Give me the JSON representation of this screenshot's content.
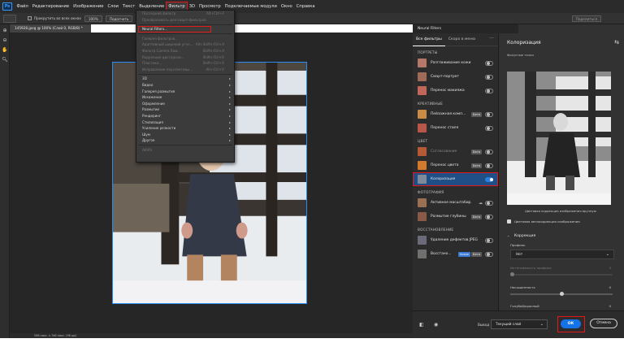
{
  "menubar": {
    "logo": "Ps",
    "items": [
      "Файл",
      "Редактирование",
      "Изображение",
      "Слои",
      "Текст",
      "Выделение",
      "Фильтр",
      "3D",
      "Просмотр",
      "Подключаемые модули",
      "Окно",
      "Справка"
    ],
    "active_index": 6
  },
  "options": {
    "scroll_all": "Прокрутить во всех окнах",
    "zoom_100": "100%",
    "fit_screen": "Подогнать",
    "full_screen": "Заполнить",
    "right_btn": "Поделиться"
  },
  "document": {
    "tab": "145928.jpeg @ 100% (Слой 0, RGB/8) *",
    "status": "598 пикс. х 746 пикс. (96 ppi)"
  },
  "filter_menu": {
    "group1": [
      {
        "label": "Последний фильтр",
        "shortcut": "Alt+Ctrl+F"
      },
      {
        "label": "Преобразовать для смарт-фильтров",
        "shortcut": ""
      }
    ],
    "neural": "Neural Filters...",
    "group2": [
      {
        "label": "Галерея фильтров...",
        "shortcut": ""
      },
      {
        "label": "Адаптивный широкий угол...",
        "shortcut": "Alt+Shift+Ctrl+A"
      },
      {
        "label": "Фильтр Camera Raw...",
        "shortcut": "Shift+Ctrl+A"
      },
      {
        "label": "Коррекция дисторсии...",
        "shortcut": "Shift+Ctrl+R"
      },
      {
        "label": "Пластика...",
        "shortcut": "Shift+Ctrl+X"
      },
      {
        "label": "Исправление перспективы...",
        "shortcut": "Alt+Ctrl+V"
      }
    ],
    "group3": [
      "3D",
      "Видео",
      "Галерея размытия",
      "Искажение",
      "Оформление",
      "Размытие",
      "Рендеринг",
      "Стилизация",
      "Усиление резкости",
      "Шум",
      "Другое"
    ],
    "group4": [
      "AKVIS"
    ]
  },
  "neural": {
    "panel_tab": "Neural Filters",
    "tabs": [
      "Все фильтры",
      "Скоро в меню"
    ],
    "more": "···",
    "categories": [
      {
        "title": "ПОРТРЕТЫ",
        "items": [
          {
            "label": "Разглаживание кожи",
            "badge": "",
            "state": "off",
            "cloud": false,
            "dim": false,
            "thumb": "#b4776a"
          },
          {
            "label": "Смарт-портрет",
            "badge": "",
            "state": "off",
            "cloud": false,
            "dim": false,
            "thumb": "#a06a58"
          },
          {
            "label": "Перенос макияжа",
            "badge": "",
            "state": "off",
            "cloud": false,
            "dim": false,
            "thumb": "#c0675a"
          }
        ]
      },
      {
        "title": "КРЕАТИВНЫЕ",
        "items": [
          {
            "label": "Пейзажная комп...",
            "badge": "Бета",
            "state": "off",
            "cloud": false,
            "dim": false,
            "thumb": "#c98b46"
          },
          {
            "label": "Перенос стиля",
            "badge": "",
            "state": "off",
            "cloud": false,
            "dim": false,
            "thumb": "#b9564a"
          }
        ]
      },
      {
        "title": "ЦВЕТ",
        "items": [
          {
            "label": "Согласование",
            "badge": "Бета",
            "state": "off",
            "cloud": false,
            "dim": true,
            "thumb": "#b45b35"
          },
          {
            "label": "Перенос цвета",
            "badge": "Бета",
            "state": "off",
            "cloud": false,
            "dim": false,
            "thumb": "#d47a2e"
          },
          {
            "label": "Колоризация",
            "badge": "",
            "state": "on",
            "cloud": false,
            "dim": false,
            "thumb": "#7e8a99",
            "selected": true
          }
        ]
      },
      {
        "title": "ФОТОГРАФИЯ",
        "items": [
          {
            "label": "Активное масштабир.",
            "badge": "",
            "state": "off",
            "cloud": true,
            "dim": false,
            "thumb": "#9a7055"
          },
          {
            "label": "Размытие глубины",
            "badge": "Бета",
            "state": "off",
            "cloud": false,
            "dim": false,
            "thumb": "#8a5a48"
          }
        ]
      },
      {
        "title": "ВОССТАНОВЛЕНИЕ",
        "items": [
          {
            "label": "Удаление дефектов JPEG",
            "badge": "",
            "state": "off",
            "cloud": false,
            "dim": false,
            "thumb": "#6a6a78"
          },
          {
            "label": "Восстано...",
            "badge": "Новое",
            "badge2": "Бета",
            "state": "off",
            "cloud": false,
            "dim": false,
            "thumb": "#70706e"
          }
        ]
      }
    ],
    "detail": {
      "title": "Колоризация",
      "preview_label": "Фокусные точки",
      "caption": "Цветовая коррекция изображения вручную",
      "auto_color": "Цветовая автокоррекция изображения",
      "correction": "Коррекция",
      "profile_label": "Профиль",
      "profile_value": "Нет",
      "profile_strength": {
        "label": "Интенсивность профиля",
        "value": "0"
      },
      "saturation": {
        "label": "Насыщенность",
        "value": "0",
        "level": 0.5
      },
      "cyan_red": {
        "label": "Голубой/красный",
        "value": "0",
        "level": 0.5
      }
    },
    "bottom": {
      "output_label": "Вывод",
      "output_value": "Текущий слой",
      "ok": "ОК",
      "cancel": "Отмена"
    }
  },
  "colors": {
    "accent": "#1473e6",
    "highlight_box": "#e31818",
    "selected_row": "#1f4f86"
  }
}
